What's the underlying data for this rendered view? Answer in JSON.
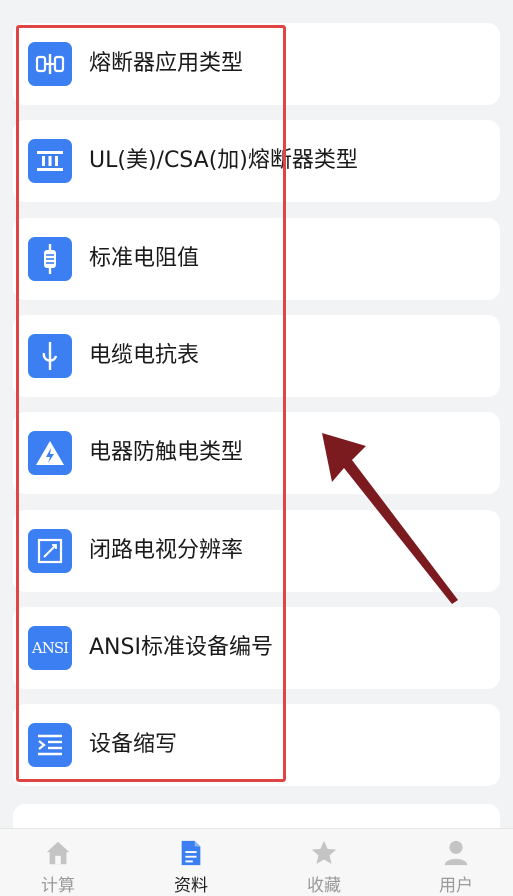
{
  "items": [
    {
      "label": "熔断器应用类型",
      "icon": "fuse-icon"
    },
    {
      "label": "UL(美)/CSA(加)熔断器类型",
      "icon": "fuse-block-icon"
    },
    {
      "label": "标准电阻值",
      "icon": "resistor-icon"
    },
    {
      "label": "电缆电抗表",
      "icon": "reactance-icon"
    },
    {
      "label": "电器防触电类型",
      "icon": "high-voltage-icon"
    },
    {
      "label": "闭路电视分辨率",
      "icon": "cctv-resolution-icon"
    },
    {
      "label": "ANSI标准设备编号",
      "icon_text": "ANSI"
    },
    {
      "label": "设备缩写",
      "icon": "abbreviation-list-icon"
    }
  ],
  "tabs": [
    {
      "label": "计算",
      "icon": "home-icon",
      "active": false
    },
    {
      "label": "资料",
      "icon": "document-icon",
      "active": true
    },
    {
      "label": "收藏",
      "icon": "star-icon",
      "active": false
    },
    {
      "label": "用户",
      "icon": "user-icon",
      "active": false
    }
  ],
  "colors": {
    "accent": "#3b7ff2",
    "highlight_box": "#e04545",
    "annotation_arrow": "#7b1a1f",
    "active_tab_icon": "#3b7ff2",
    "inactive_tab_icon": "#c4c4c4"
  }
}
